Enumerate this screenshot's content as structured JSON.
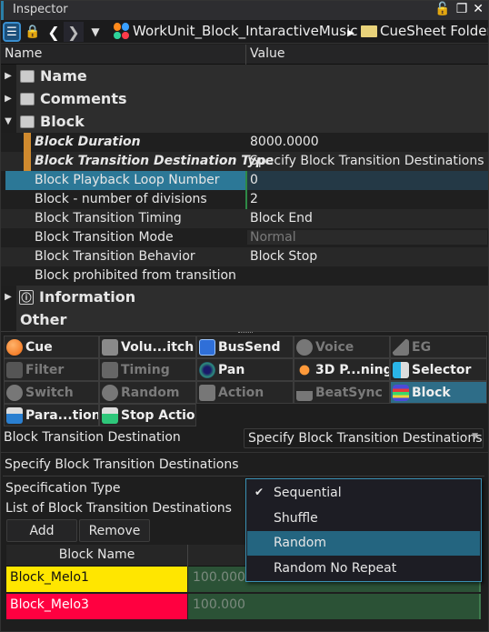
{
  "window": {
    "title": "Inspector"
  },
  "toolbar": {
    "breadcrumb": [
      {
        "label": "WorkUnit_Block_IntaractiveMusic",
        "icon": "workunit-icon"
      },
      {
        "label": "CueSheet Folder",
        "icon": "folder-icon"
      }
    ]
  },
  "grid": {
    "columns": {
      "name": "Name",
      "value": "Value"
    },
    "categories": {
      "name": "Name",
      "comments": "Comments",
      "block": "Block",
      "information": "Information",
      "other": "Other"
    },
    "block_rows": [
      {
        "name": "Block Duration",
        "value": "8000.0000"
      },
      {
        "name": "Block Transition Destination Type",
        "value": "Specify Block Transition Destinations"
      },
      {
        "name": "Block Playback Loop Number",
        "value": "0"
      },
      {
        "name": "Block - number of divisions",
        "value": "2"
      },
      {
        "name": "Block Transition Timing",
        "value": "Block End"
      },
      {
        "name": "Block Transition Mode",
        "value": "Normal"
      },
      {
        "name": "Block Transition Behavior",
        "value": "Block Stop"
      },
      {
        "name": "Block prohibited from transition",
        "value": ""
      }
    ]
  },
  "tabs": [
    {
      "label": "Cue",
      "enabled": true
    },
    {
      "label": "Volu...itch",
      "enabled": true
    },
    {
      "label": "BusSend",
      "enabled": true
    },
    {
      "label": "Voice",
      "enabled": false
    },
    {
      "label": "EG",
      "enabled": false
    },
    {
      "label": "Filter",
      "enabled": false
    },
    {
      "label": "Timing",
      "enabled": false
    },
    {
      "label": "Pan",
      "enabled": true
    },
    {
      "label": "3D P...ning",
      "enabled": true
    },
    {
      "label": "Selector",
      "enabled": true
    },
    {
      "label": "Switch",
      "enabled": false
    },
    {
      "label": "Random",
      "enabled": false
    },
    {
      "label": "Action",
      "enabled": false
    },
    {
      "label": "BeatSync",
      "enabled": false
    },
    {
      "label": "Block",
      "enabled": true,
      "active": true
    },
    {
      "label": "Para...tion",
      "enabled": true
    },
    {
      "label": "Stop Action",
      "enabled": true
    }
  ],
  "panel": {
    "transition_destination_label": "Block Transition Destination",
    "transition_destination_value": "Specify Block Transition Destinations",
    "section_title": "Specify Block Transition Destinations",
    "spec_type_label": "Specification Type",
    "list_label": "List of Block Transition Destinations",
    "add_label": "Add",
    "remove_label": "Remove",
    "table": {
      "header_block_name": "Block Name",
      "rows": [
        {
          "name": "Block_Melo1",
          "value": "100.000",
          "color": "#ffe600"
        },
        {
          "name": "Block_Melo3",
          "value": "100.000",
          "color": "#ff0040"
        }
      ]
    }
  },
  "dropdown": {
    "options": [
      {
        "label": "Sequential",
        "checked": true
      },
      {
        "label": "Shuffle",
        "checked": false
      },
      {
        "label": "Random",
        "checked": false,
        "highlighted": true
      },
      {
        "label": "Random No Repeat",
        "checked": false
      }
    ]
  }
}
